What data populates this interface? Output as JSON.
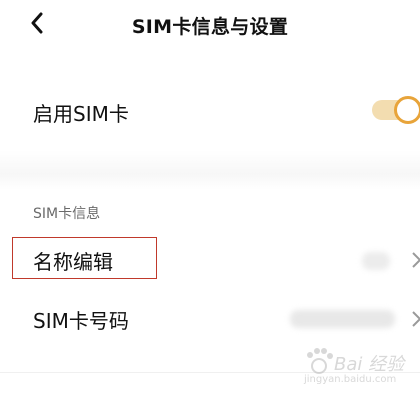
{
  "header": {
    "back_icon": "chevron-left-icon",
    "title": "SIM卡信息与设置"
  },
  "enable_sim": {
    "label": "启用SIM卡",
    "enabled": true,
    "accent_color": "#e8a43a"
  },
  "section_sim_info": {
    "heading": "SIM卡信息",
    "items": [
      {
        "label": "名称编辑",
        "value_visible": false,
        "highlight_color": "#c0392b"
      },
      {
        "label": "SIM卡号码",
        "value_visible": false
      }
    ]
  },
  "watermark": {
    "text": "Bai 经验",
    "sub": "jingyan.baidu.com"
  }
}
